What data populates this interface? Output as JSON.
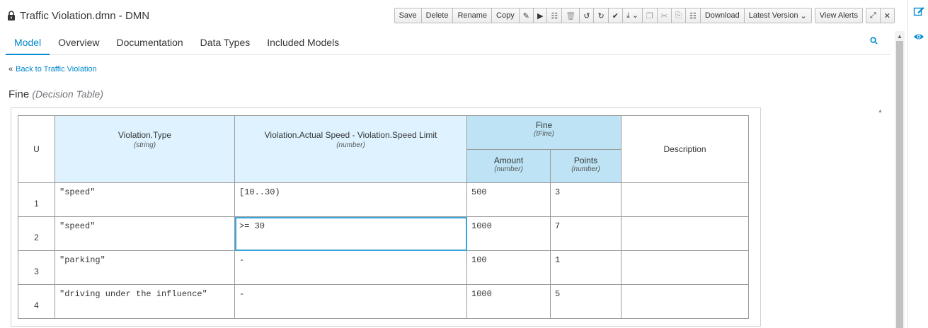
{
  "window": {
    "title": "Traffic Violation.dmn - DMN"
  },
  "toolbar": {
    "save": "Save",
    "delete": "Delete",
    "rename": "Rename",
    "copy": "Copy",
    "download": "Download",
    "latest_version": "Latest Version",
    "view_alerts": "View Alerts"
  },
  "tabs": [
    {
      "label": "Model"
    },
    {
      "label": "Overview"
    },
    {
      "label": "Documentation"
    },
    {
      "label": "Data Types"
    },
    {
      "label": "Included Models"
    }
  ],
  "back_link": "Back to Traffic Violation",
  "heading": {
    "name": "Fine",
    "kind": "(Decision Table)"
  },
  "table": {
    "hit_policy": "U",
    "inputs": [
      {
        "name": "Violation.Type",
        "type": "(string)"
      },
      {
        "name": "Violation.Actual Speed - Violation.Speed Limit",
        "type": "(number)"
      }
    ],
    "output": {
      "name": "Fine",
      "type": "(tFine)",
      "columns": [
        {
          "name": "Amount",
          "type": "(number)"
        },
        {
          "name": "Points",
          "type": "(number)"
        }
      ]
    },
    "annotation": "Description",
    "rows": [
      {
        "n": "1",
        "type": "\"speed\"",
        "speed": "[10..30)",
        "amount": "500",
        "points": "3",
        "desc": ""
      },
      {
        "n": "2",
        "type": "\"speed\"",
        "speed": ">= 30",
        "amount": "1000",
        "points": "7",
        "desc": ""
      },
      {
        "n": "3",
        "type": "\"parking\"",
        "speed": "-",
        "amount": "100",
        "points": "1",
        "desc": ""
      },
      {
        "n": "4",
        "type": "\"driving under the influence\"",
        "speed": "-",
        "amount": "1000",
        "points": "5",
        "desc": ""
      }
    ]
  },
  "colors": {
    "accent": "#0088ce",
    "input_header": "#def3ff",
    "output_header": "#bde3f4",
    "selection": "#39a5dc"
  }
}
